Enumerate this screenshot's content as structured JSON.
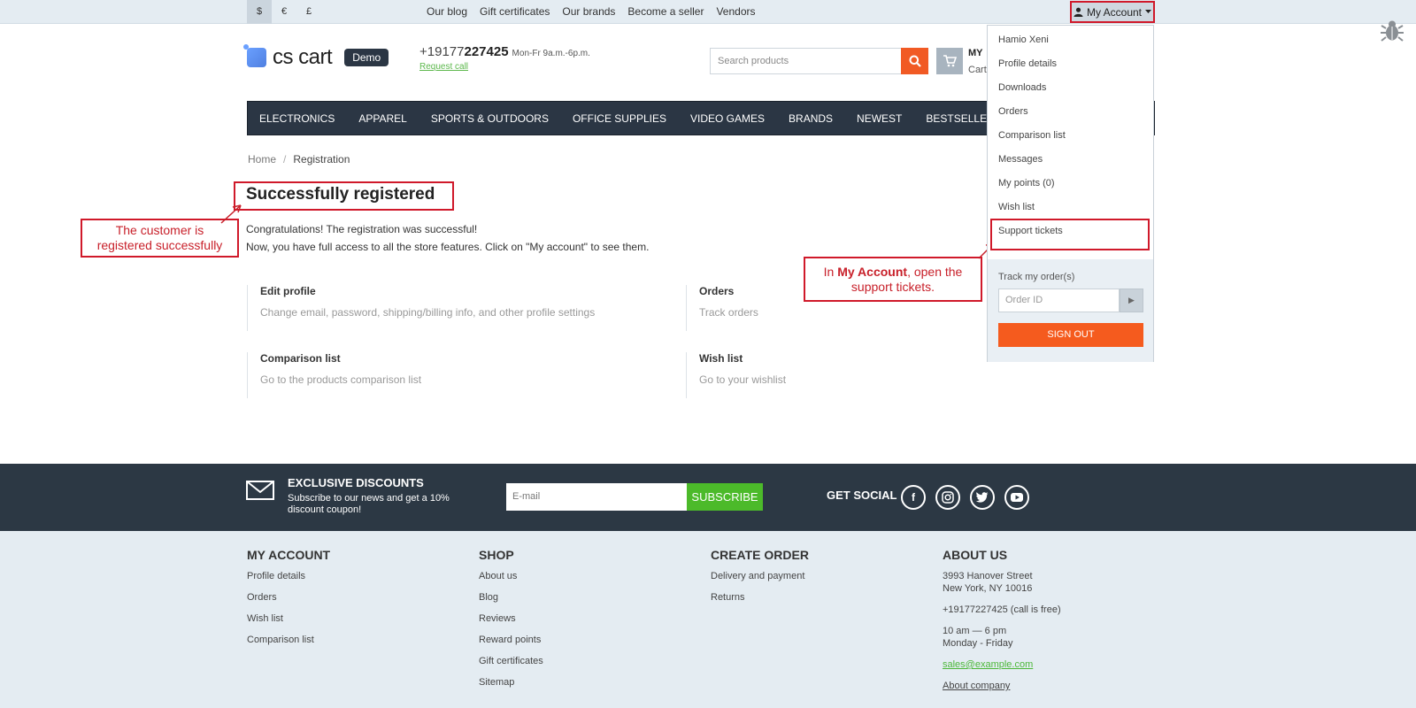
{
  "topbar": {
    "currencies": [
      "$",
      "€",
      "£"
    ],
    "links": [
      "Our blog",
      "Gift certificates",
      "Our brands",
      "Become a seller",
      "Vendors"
    ],
    "my_account": "My Account"
  },
  "header": {
    "logo": "cs cart",
    "demo": "Demo",
    "phone_prefix": "+19177",
    "phone_bold": "227425",
    "hours": "Mon-Fr 9a.m.-6p.m.",
    "request_call": "Request call",
    "search_placeholder": "Search products",
    "cart_title": "MY",
    "cart_sub": "Cart"
  },
  "nav": [
    "Electronics",
    "Apparel",
    "Sports & Outdoors",
    "Office Supplies",
    "Video Games",
    "Brands",
    "Newest",
    "Bestsellers"
  ],
  "breadcrumb": {
    "home": "Home",
    "sep": "/",
    "current": "Registration"
  },
  "main": {
    "title": "Successfully registered",
    "line1": "Congratulations! The registration was successful!",
    "line2": "Now, you have full access to all the store features. Click on \"My account\" to see them.",
    "blocks": [
      {
        "heading": "Edit profile",
        "desc": "Change email, password, shipping/billing info, and other profile settings"
      },
      {
        "heading": "Orders",
        "desc": "Track orders"
      },
      {
        "heading": "Comparison list",
        "desc": "Go to the products comparison list"
      },
      {
        "heading": "Wish list",
        "desc": "Go to your wishlist"
      }
    ]
  },
  "annotations": {
    "left_line1": "The customer is",
    "left_line2": "registered successfully",
    "right_pre": "In ",
    "right_bold": "My Account",
    "right_post": ", open the",
    "right_line2": "support tickets."
  },
  "dropdown": {
    "items": [
      "Hamio Xeni",
      "Profile details",
      "Downloads",
      "Orders",
      "Comparison list",
      "Messages",
      "My points (0)",
      "Wish list",
      "Support tickets"
    ],
    "track_label": "Track my order(s)",
    "order_placeholder": "Order ID",
    "sign_out": "Sign out"
  },
  "newsletter": {
    "heading": "EXCLUSIVE DISCOUNTS",
    "text": "Subscribe to our news and get a 10% discount coupon!",
    "email_placeholder": "E-mail",
    "subscribe": "SUBSCRIBE",
    "social": "GET SOCIAL"
  },
  "footer": {
    "my_account": {
      "title": "MY ACCOUNT",
      "links": [
        "Profile details",
        "Orders",
        "Wish list",
        "Comparison list"
      ]
    },
    "shop": {
      "title": "SHOP",
      "links": [
        "About us",
        "Blog",
        "Reviews",
        "Reward points",
        "Gift certificates",
        "Sitemap"
      ]
    },
    "create_order": {
      "title": "CREATE ORDER",
      "links": [
        "Delivery and payment",
        "Returns"
      ]
    },
    "about": {
      "title": "ABOUT US",
      "addr1": "3993 Hanover Street",
      "addr2": "New York, NY 10016",
      "phone": "+19177227425 (call is free)",
      "hours1": "10 am — 6 pm",
      "hours2": "Monday - Friday",
      "email": "sales@example.com",
      "company": "About company"
    }
  },
  "colors": {
    "accent": "#f15a24",
    "nav_bg": "#2b3644",
    "highlight": "#d0192a",
    "green": "#4cba2a"
  }
}
